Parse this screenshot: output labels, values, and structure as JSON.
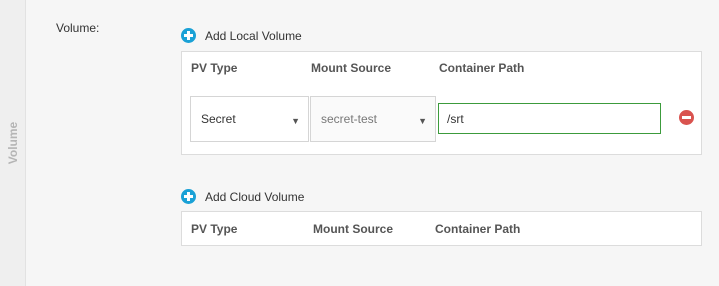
{
  "side_tab": {
    "label": "Volume"
  },
  "volume": {
    "label": "Volume:",
    "local": {
      "add_label": "Add Local Volume",
      "columns": [
        "PV Type",
        "Mount Source",
        "Container Path"
      ],
      "rows": [
        {
          "pv_type": "Secret",
          "mount_source": "secret-test",
          "container_path": "/srt"
        }
      ]
    },
    "cloud": {
      "add_label": "Add Cloud Volume",
      "columns": [
        "PV Type",
        "Mount Source",
        "Container Path"
      ],
      "rows": []
    }
  },
  "colors": {
    "add_icon": "#1aa1d6",
    "remove_icon": "#d9534f",
    "focused_input_border": "#3c9b3c"
  },
  "icons": {
    "add": "plus-circle-icon",
    "remove": "minus-circle-icon",
    "dropdown": "caret-down-icon"
  }
}
